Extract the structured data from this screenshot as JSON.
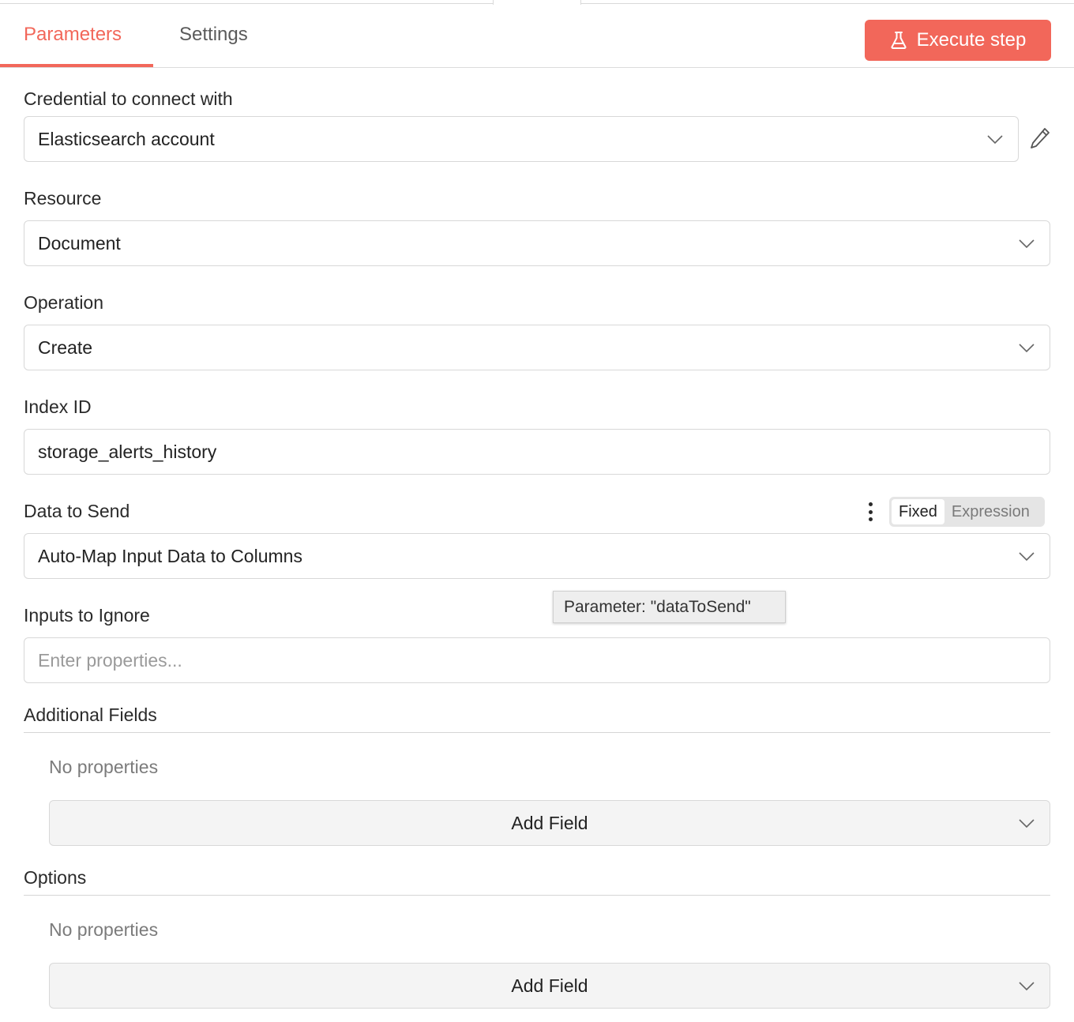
{
  "tabs": {
    "parameters": "Parameters",
    "settings": "Settings"
  },
  "execute_button": {
    "label": "Execute step",
    "icon": "flask-icon"
  },
  "colors": {
    "accent": "#f2675a"
  },
  "fields": {
    "credential": {
      "label": "Credential to connect with",
      "value": "Elasticsearch account"
    },
    "resource": {
      "label": "Resource",
      "value": "Document"
    },
    "operation": {
      "label": "Operation",
      "value": "Create"
    },
    "index_id": {
      "label": "Index ID",
      "value": "storage_alerts_history"
    },
    "data_to_send": {
      "label": "Data to Send",
      "value": "Auto-Map Input Data to Columns",
      "mode_fixed": "Fixed",
      "mode_expression": "Expression",
      "tooltip": "Parameter: \"dataToSend\""
    },
    "inputs_to_ignore": {
      "label": "Inputs to Ignore",
      "placeholder": "Enter properties..."
    }
  },
  "additional_fields": {
    "title": "Additional Fields",
    "empty_text": "No properties",
    "add_label": "Add Field"
  },
  "options": {
    "title": "Options",
    "empty_text": "No properties",
    "add_label": "Add Field"
  }
}
